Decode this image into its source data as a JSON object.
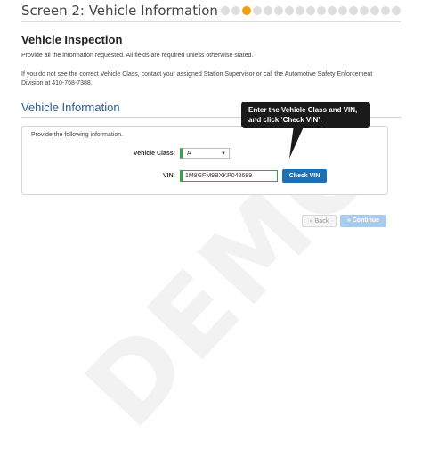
{
  "watermark": "DEMO",
  "header": {
    "title": "Screen 2: Vehicle Information",
    "progress": {
      "total_steps": 17,
      "current_step": 3
    }
  },
  "inspection": {
    "title": "Vehicle Inspection",
    "intro": "Provide all the information requested. All fields are required unless otherwise stated.",
    "note": "If you do not see the correct Vehicle Class, contact your assigned Station Supervisor or call the Automotive Safety Enforcement Division at 410-768-7388."
  },
  "vehicle_info": {
    "title": "Vehicle Information",
    "hint": "Provide the following information.",
    "class_label": "Vehicle Class:",
    "class_value": "A",
    "vin_label": "VIN:",
    "vin_value": "1M8GFM9BXKP042689",
    "check_vin_label": "Check VIN"
  },
  "callout": {
    "line1": "Enter the Vehicle Class and VIN,",
    "line2": "and click ‘Check VIN’."
  },
  "nav": {
    "back_label": "« Back",
    "continue_label": "» Continue"
  },
  "colors": {
    "accent_orange": "#f39c12",
    "primary_blue": "#1f6fb5",
    "heading_blue": "#2a5d8f",
    "valid_green": "#3aa34a"
  }
}
